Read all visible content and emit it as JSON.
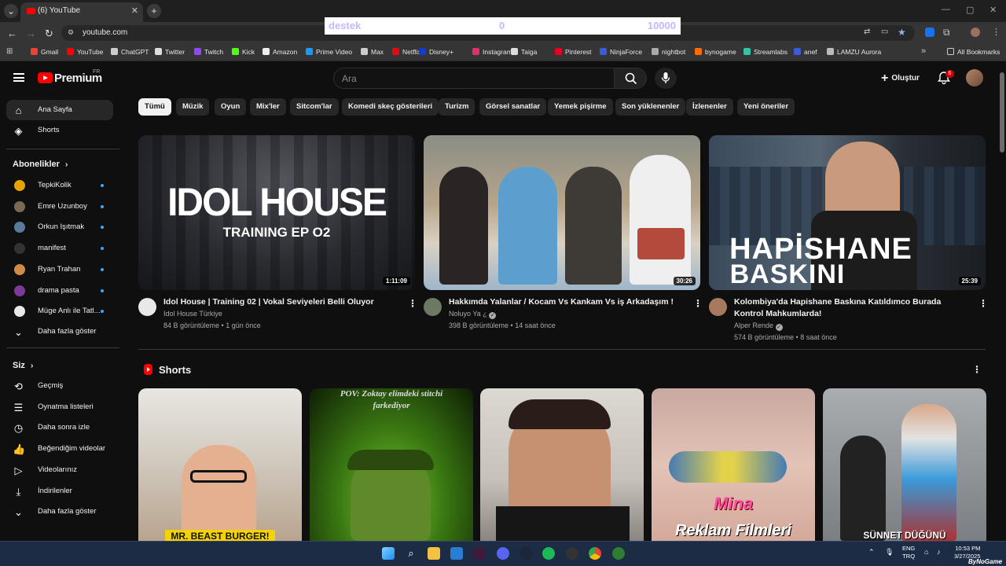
{
  "browser": {
    "tab_title": "(6) YouTube",
    "url": "youtube.com",
    "bookmarks": [
      {
        "label": "Gmail",
        "color": "#ea4335"
      },
      {
        "label": "YouTube",
        "color": "#ff0000"
      },
      {
        "label": "ChatGPT",
        "color": "#cccccc"
      },
      {
        "label": "Twitter",
        "color": "#dddddd"
      },
      {
        "label": "Twitch",
        "color": "#9146ff"
      },
      {
        "label": "Kick",
        "color": "#53fc18"
      },
      {
        "label": "Amazon",
        "color": "#eeeeee"
      },
      {
        "label": "Prime Video",
        "color": "#1a98ff"
      },
      {
        "label": "Max",
        "color": "#cccccc"
      },
      {
        "label": "Netflix",
        "color": "#e50914"
      },
      {
        "label": "Disney+",
        "color": "#113ccf"
      },
      {
        "label": "Instagram",
        "color": "#e1306c"
      },
      {
        "label": "Taiga",
        "color": "#dddddd"
      },
      {
        "label": "Pinterest",
        "color": "#e60023"
      },
      {
        "label": "NinjaForce",
        "color": "#3b5bdb"
      },
      {
        "label": "nightbot",
        "color": "#aaaaaa"
      },
      {
        "label": "bynogame",
        "color": "#ff6b00"
      },
      {
        "label": "Streamlabs",
        "color": "#31c3a2"
      },
      {
        "label": "anef",
        "color": "#3b5bdb"
      },
      {
        "label": "LAMZU Aurora",
        "color": "#bbbbbb"
      }
    ],
    "all_bookmarks": "All Bookmarks"
  },
  "overlay": {
    "label": "destek",
    "current": "0",
    "goal": "10000"
  },
  "header": {
    "premium_label": "Premium",
    "region": "FR",
    "search_placeholder": "Ara",
    "create_label": "Oluştur",
    "notifications": "6"
  },
  "sidebar": {
    "main": [
      {
        "label": "Ana Sayfa",
        "icon": "home-icon"
      },
      {
        "label": "Shorts",
        "icon": "shorts-icon"
      }
    ],
    "subscriptions_title": "Abonelikler",
    "subscriptions": [
      {
        "label": "TepkiKolik",
        "color": "#e7a400"
      },
      {
        "label": "Emre Uzunboy",
        "color": "#7a6a55"
      },
      {
        "label": "Orkun Işıtmak",
        "color": "#5a7a9a"
      },
      {
        "label": "manifest",
        "color": "#333333"
      },
      {
        "label": "Ryan Trahan",
        "color": "#d08a4a"
      },
      {
        "label": "drama pasta",
        "color": "#7a3a9a"
      },
      {
        "label": "Müge Anlı ile Tatl...",
        "color": "#e8e8e8"
      }
    ],
    "show_more": "Daha fazla göster",
    "you_title": "Siz",
    "you_items": [
      {
        "label": "Geçmiş",
        "icon": "history-icon"
      },
      {
        "label": "Oynatma listeleri",
        "icon": "playlist-icon"
      },
      {
        "label": "Daha sonra izle",
        "icon": "clock-icon"
      },
      {
        "label": "Beğendiğim videolar",
        "icon": "like-icon"
      },
      {
        "label": "Videolarınız",
        "icon": "your-videos-icon"
      },
      {
        "label": "İndirilenler",
        "icon": "download-icon"
      },
      {
        "label": "Daha fazla göster",
        "icon": "chevron-down-icon"
      }
    ]
  },
  "chips": [
    "Tümü",
    "Müzik",
    "Oyun",
    "Mix'ler",
    "Sitcom'lar",
    "Komedi skeç gösterileri",
    "Turizm",
    "Görsel sanatlar",
    "Yemek pişirme",
    "Son yüklenenler",
    "İzlenenler",
    "Yeni öneriler"
  ],
  "videos": [
    {
      "title": "Idol House | Training 02 | Vokal Seviyeleri Belli Oluyor",
      "channel": "Idol House Türkiye",
      "meta": "84 B görüntüleme • 1 gün önce",
      "duration": "1:11:09",
      "verified": false,
      "thumb_line1": "IDOL HOUSE",
      "thumb_line2": "TRAINING EP O2"
    },
    {
      "title": "Hakkımda Yalanlar / Kocam Vs Kankam Vs iş Arkadaşım !",
      "channel": "Noluyo Ya ¿",
      "meta": "398 B görüntüleme • 14 saat önce",
      "duration": "30:26",
      "verified": true,
      "thumb_line1": "",
      "thumb_line2": ""
    },
    {
      "title": "Kolombiya'da Hapishane Baskına Katıldımco Burada Kontrol Mahkumlarda!",
      "channel": "Alper Rende",
      "meta": "574 B görüntüleme • 8 saat önce",
      "duration": "25:39",
      "verified": true,
      "thumb_line1": "HAPİSHANE",
      "thumb_line2": "BASKINI"
    }
  ],
  "shorts": {
    "title": "Shorts",
    "items": [
      {
        "caption": "MR. BEAST BURGER!",
        "top_text": ""
      },
      {
        "caption": "",
        "top_text": "POV: Zoktay elimdeki stitchi farkediyor"
      },
      {
        "caption": "",
        "top_text": ""
      },
      {
        "caption": "Reklam Filmleri",
        "top_text": "Mina"
      },
      {
        "caption": "SÜNNET DÜĞÜNÜ",
        "top_text": ""
      }
    ]
  },
  "taskbar": {
    "lang_line1": "ENG",
    "lang_line2": "TRQ",
    "time": "10:53 PM",
    "date": "3/27/2025",
    "brand": "ByNoGame"
  }
}
